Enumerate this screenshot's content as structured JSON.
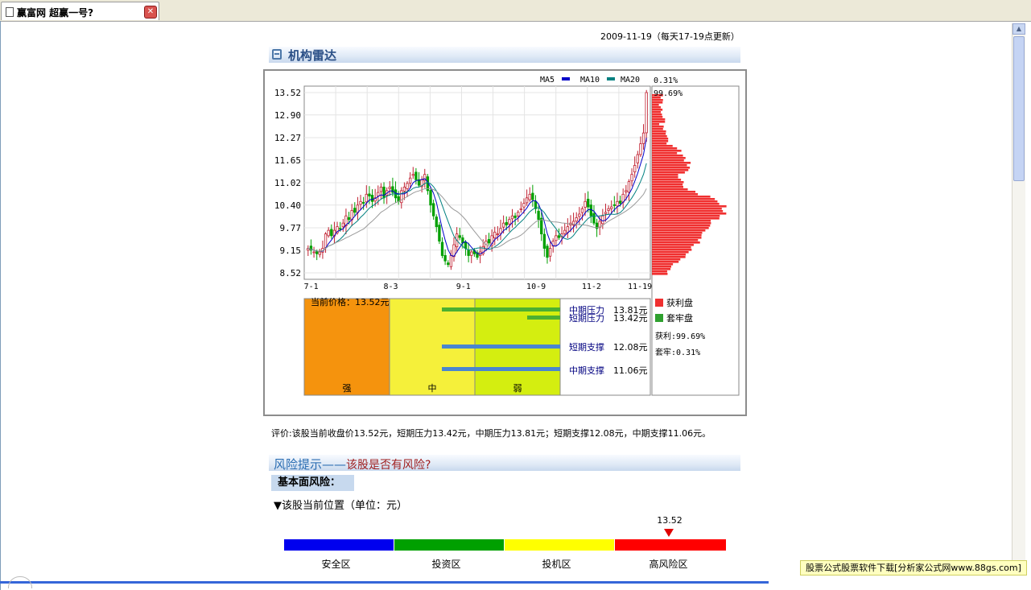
{
  "tab": {
    "title": "赢富网  超赢一号?"
  },
  "update_date": "2009-11-19（每天17-19点更新）",
  "radar": {
    "title": "机构雷达",
    "legend": {
      "ma5": "MA5",
      "ma10": "MA10",
      "ma20": "MA20"
    },
    "colors": {
      "ma5": "#0000c8",
      "ma10": "#008080",
      "ma20": "#9a9a9a",
      "up": "#c02030",
      "down": "#00a000",
      "profit": "#f03030",
      "trapped": "#2ea02e"
    },
    "dist_top_pct": "0.31%",
    "dist_profit_pct": "99.69%",
    "current_price_label": "当前价格：13.52元",
    "levels": [
      {
        "name": "中期压力",
        "value": "13.81元"
      },
      {
        "name": "短期压力",
        "value": "13.42元"
      },
      {
        "name": "短期支撑",
        "value": "12.08元"
      },
      {
        "name": "中期支撑",
        "value": "11.06元"
      }
    ],
    "zones": {
      "strong": "强",
      "mid": "中",
      "weak": "弱"
    },
    "dist_legend": {
      "profit": "获利盘",
      "trapped": "套牢盘"
    },
    "profit_text": "获利:99.69%",
    "trapped_text": "套牢:0.31%"
  },
  "chart_data": {
    "type": "candlestick",
    "ylabel_ticks": [
      "13.52",
      "12.90",
      "12.27",
      "11.65",
      "11.02",
      "10.40",
      "9.77",
      "9.15",
      "8.52"
    ],
    "xlabel_ticks": [
      "7-1",
      "8-3",
      "9-1",
      "10-9",
      "11-2",
      "11-19"
    ],
    "ylim": [
      8.52,
      13.52
    ],
    "closes": [
      9.2,
      9.15,
      9.1,
      9.05,
      9.1,
      9.2,
      9.6,
      9.7,
      9.55,
      9.7,
      9.8,
      9.75,
      9.9,
      10.1,
      10.0,
      10.25,
      10.2,
      10.4,
      10.5,
      10.45,
      10.7,
      10.65,
      10.5,
      10.6,
      10.75,
      10.9,
      10.6,
      10.8,
      10.9,
      10.75,
      10.6,
      10.5,
      10.8,
      10.9,
      11.0,
      11.15,
      11.25,
      11.1,
      10.95,
      11.1,
      11.25,
      10.8,
      10.4,
      10.1,
      9.8,
      9.4,
      9.0,
      8.85,
      8.75,
      9.0,
      9.3,
      9.6,
      9.5,
      9.35,
      9.2,
      9.0,
      9.1,
      9.05,
      8.95,
      9.1,
      9.25,
      9.4,
      9.35,
      9.55,
      9.65,
      9.6,
      9.75,
      9.9,
      9.85,
      10.0,
      10.1,
      10.05,
      10.2,
      10.3,
      10.45,
      10.6,
      10.7,
      10.55,
      10.3,
      10.0,
      9.6,
      9.2,
      8.95,
      9.2,
      9.4,
      9.55,
      9.5,
      9.6,
      9.7,
      9.8,
      9.9,
      9.95,
      10.05,
      10.15,
      10.3,
      10.5,
      10.35,
      10.1,
      9.9,
      9.75,
      9.95,
      10.1,
      10.2,
      10.3,
      10.35,
      10.4,
      10.5,
      10.45,
      10.7,
      10.8,
      11.05,
      11.25,
      11.5,
      11.8,
      12.1,
      12.4,
      13.52
    ]
  },
  "evaluation": "评价:该股当前收盘价13.52元，短期压力13.42元，中期压力13.81元；短期支撑12.08元，中期支撑11.06元。",
  "risk": {
    "title": "风险提示",
    "dash": "——",
    "subtitle": "该股是否有风险?",
    "fundamental_label": "基本面风险：",
    "position_label": "▼该股当前位置（单位：元）",
    "current_value": "13.52",
    "zones": [
      "安全区",
      "投资区",
      "投机区",
      "高风险区"
    ],
    "zone_colors": [
      "#0000ee",
      "#00a000",
      "#ffff00",
      "#ff0000"
    ]
  },
  "ad_text": "股票公式股票软件下载[分析家公式网www.88gs.com]"
}
